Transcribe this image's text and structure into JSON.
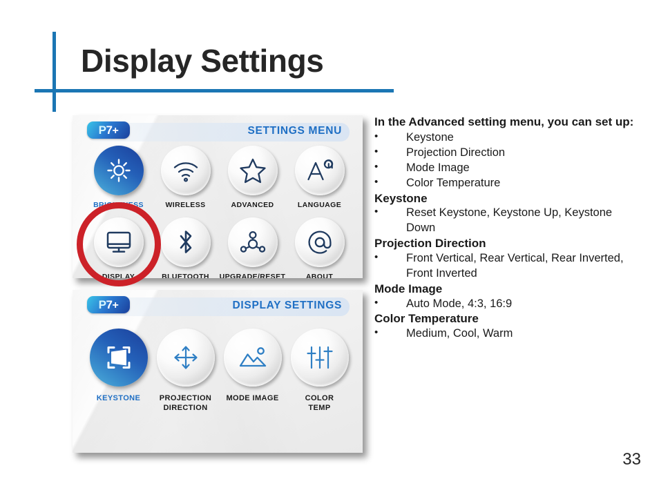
{
  "slide": {
    "title": "Display Settings",
    "page_number": "33",
    "accent_color": "#1b76b4",
    "highlight_color": "#cc2128"
  },
  "settings_menu_screen": {
    "logo": "P7+",
    "logo_p": "P",
    "logo_7": "7",
    "logo_plus": "+",
    "header_title": "SETTINGS MENU",
    "items": [
      {
        "label": "BRIGHTNESS",
        "icon": "sun-icon",
        "selected": true
      },
      {
        "label": "WIRELESS",
        "icon": "wifi-icon",
        "selected": false
      },
      {
        "label": "ADVANCED",
        "icon": "star-icon",
        "selected": false
      },
      {
        "label": "LANGUAGE",
        "icon": "language-aa-icon",
        "selected": false
      },
      {
        "label": "DISPLAY",
        "icon": "monitor-icon",
        "selected": false
      },
      {
        "label": "BLUETOOTH",
        "icon": "bluetooth-icon",
        "selected": false
      },
      {
        "label": "UPGRADE/RESET",
        "icon": "network-nodes-icon",
        "selected": false
      },
      {
        "label": "ABOUT",
        "icon": "at-sign-icon",
        "selected": false
      }
    ],
    "highlighted_item": "DISPLAY"
  },
  "display_settings_screen": {
    "logo": "P7+",
    "logo_p": "P",
    "logo_7": "7",
    "logo_plus": "+",
    "header_title": "DISPLAY SETTINGS",
    "items": [
      {
        "label": "KEYSTONE",
        "icon": "keystone-frame-icon",
        "selected": true
      },
      {
        "label": "PROJECTION\nDIRECTION",
        "icon": "four-way-arrows-icon",
        "selected": false
      },
      {
        "label": "MODE IMAGE",
        "icon": "picture-icon",
        "selected": false
      },
      {
        "label": "COLOR\nTEMP",
        "icon": "sliders-icon",
        "selected": false
      }
    ]
  },
  "notes": {
    "intro_heading": "In the Advanced setting menu, you can set up:",
    "intro_items": [
      "Keystone",
      "Projection Direction",
      "Mode Image",
      "Color Temperature"
    ],
    "sections": [
      {
        "heading": "Keystone",
        "items": [
          "Reset Keystone, Keystone Up, Keystone Down"
        ]
      },
      {
        "heading": "Projection Direction",
        "items": [
          "Front Vertical, Rear Vertical, Rear Inverted, Front Inverted"
        ]
      },
      {
        "heading": "Mode Image",
        "items": [
          "Auto Mode, 4:3, 16:9"
        ]
      },
      {
        "heading": "Color Temperature",
        "items": [
          "Medium, Cool, Warm"
        ]
      }
    ]
  }
}
